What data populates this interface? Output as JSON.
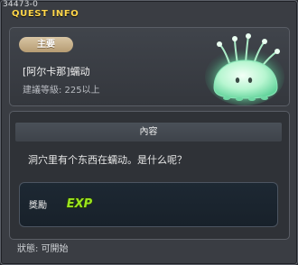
{
  "window": {
    "id": "34473-0",
    "title": "QUEST INFO"
  },
  "header": {
    "badge": "主要",
    "quest_name": "[阿尔卡那]蠕动",
    "required_level": "建議等級: 225以上",
    "creature_icon": "glowing-jelly-creature"
  },
  "content": {
    "heading": "內容",
    "text": "洞穴里有个东西在蠕动。是什么呢？"
  },
  "reward": {
    "label": "獎勵",
    "item": "EXP"
  },
  "status": "狀態: 可開始",
  "colors": {
    "title": "#ffd64a",
    "badge": "#c7b08a",
    "exp": "#9be51f"
  }
}
